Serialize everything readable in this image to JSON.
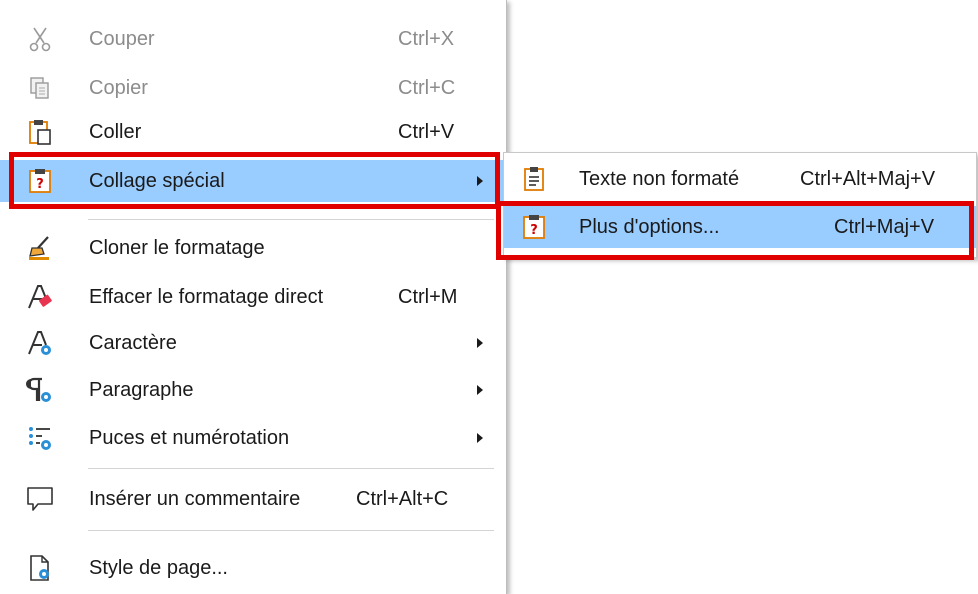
{
  "menu": {
    "items": [
      {
        "label": "Couper",
        "shortcut": "Ctrl+X",
        "icon": "scissors-icon",
        "disabled": true
      },
      {
        "label": "Copier",
        "shortcut": "Ctrl+C",
        "icon": "copy-icon",
        "disabled": true
      },
      {
        "label": "Coller",
        "shortcut": "Ctrl+V",
        "icon": "paste-icon",
        "disabled": false
      },
      {
        "label": "Collage spécial",
        "shortcut": "",
        "icon": "paste-special-icon",
        "submenu": true,
        "highlighted": true
      },
      {
        "label": "Cloner le formatage",
        "shortcut": "",
        "icon": "clone-formatting-icon"
      },
      {
        "label": "Effacer le formatage direct",
        "shortcut": "Ctrl+M",
        "icon": "clear-formatting-icon"
      },
      {
        "label": "Caractère",
        "shortcut": "",
        "icon": "character-icon",
        "submenu": true
      },
      {
        "label": "Paragraphe",
        "shortcut": "",
        "icon": "paragraph-icon",
        "submenu": true
      },
      {
        "label": "Puces et numérotation",
        "shortcut": "",
        "icon": "bullets-numbering-icon",
        "submenu": true
      },
      {
        "label": "Insérer un commentaire",
        "shortcut": "Ctrl+Alt+C",
        "icon": "comment-icon"
      },
      {
        "label": "Style de page...",
        "shortcut": "",
        "icon": "page-style-icon"
      }
    ]
  },
  "submenu": {
    "items": [
      {
        "label": "Texte non formaté",
        "shortcut": "Ctrl+Alt+Maj+V",
        "icon": "unformatted-text-icon"
      },
      {
        "label": "Plus d'options...",
        "shortcut": "Ctrl+Maj+V",
        "icon": "paste-special-icon",
        "highlighted": true
      }
    ]
  },
  "colors": {
    "highlight": "#99ccff",
    "annotation_border": "#e00000",
    "disabled_text": "#8c8c8c"
  }
}
